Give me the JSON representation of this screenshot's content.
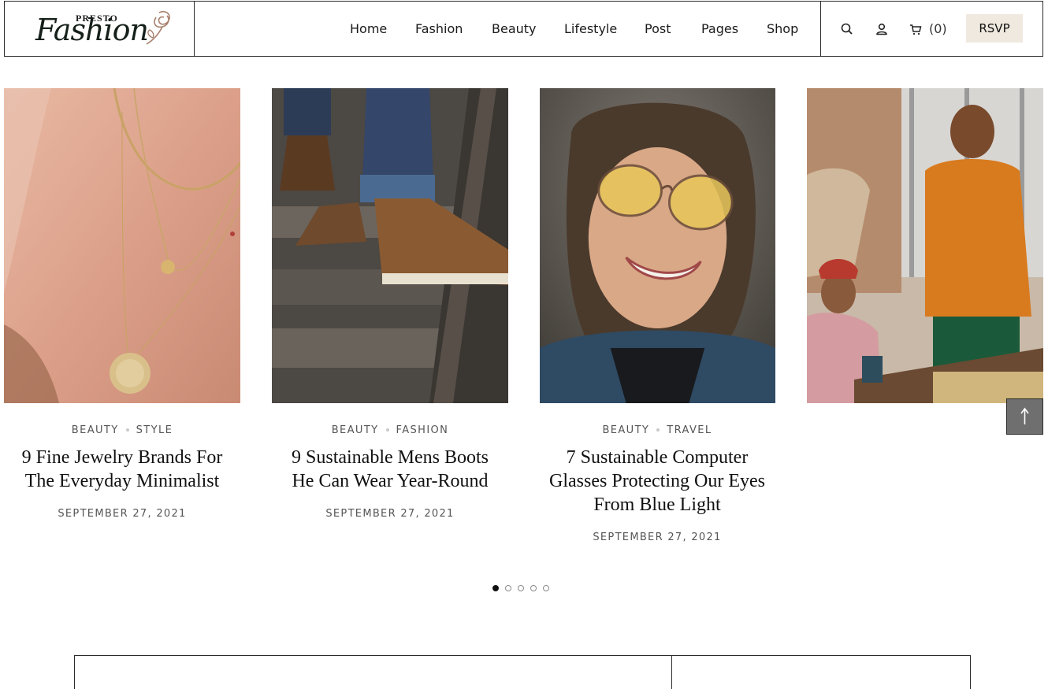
{
  "brand": {
    "small_text": "PRESTO",
    "script_text": "Fashion"
  },
  "nav": {
    "items": [
      "Home",
      "Fashion",
      "Beauty",
      "Lifestyle",
      "Post",
      "Pages",
      "Shop"
    ]
  },
  "tools": {
    "search_icon": "search-icon",
    "user_icon": "user-icon",
    "cart_icon": "cart-icon",
    "cart_count": "(0)",
    "rsvp_label": "RSVP"
  },
  "posts": [
    {
      "categories": [
        "BEAUTY",
        "STYLE"
      ],
      "title_lines": [
        "9 Fine Jewelry Brands For",
        "The Everyday Minimalist"
      ],
      "date": "SEPTEMBER 27, 2021"
    },
    {
      "categories": [
        "BEAUTY",
        "FASHION"
      ],
      "title_lines": [
        "9 Sustainable Mens Boots",
        "He Can Wear Year-Round"
      ],
      "date": "SEPTEMBER 27, 2021"
    },
    {
      "categories": [
        "BEAUTY",
        "TRAVEL"
      ],
      "title_lines": [
        "7 Sustainable Computer",
        "Glasses Protecting Our Eyes",
        "From Blue Light"
      ],
      "date": "SEPTEMBER 27, 2021"
    }
  ],
  "pagination": {
    "total": 5,
    "active": 1
  },
  "colors": {
    "rsvp_bg": "#efe9df",
    "border": "#2b2b2b",
    "text_muted": "#555555"
  }
}
